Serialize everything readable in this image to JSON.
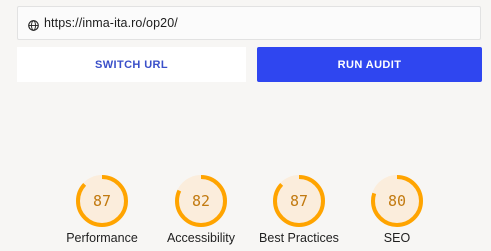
{
  "url_bar": {
    "url": "https://inma-ita.ro/op20/",
    "icon": "globe-icon"
  },
  "buttons": {
    "switch_url": "SWITCH URL",
    "run_audit": "RUN AUDIT"
  },
  "scores": [
    {
      "label": "Performance",
      "value": "87",
      "fraction": 0.87
    },
    {
      "label": "Accessibility",
      "value": "82",
      "fraction": 0.82
    },
    {
      "label": "Best Practices",
      "value": "87",
      "fraction": 0.87
    },
    {
      "label": "SEO",
      "value": "80",
      "fraction": 0.8
    }
  ],
  "colors": {
    "score_average": "#ffa400",
    "run_audit_bg": "#2f46f0"
  }
}
